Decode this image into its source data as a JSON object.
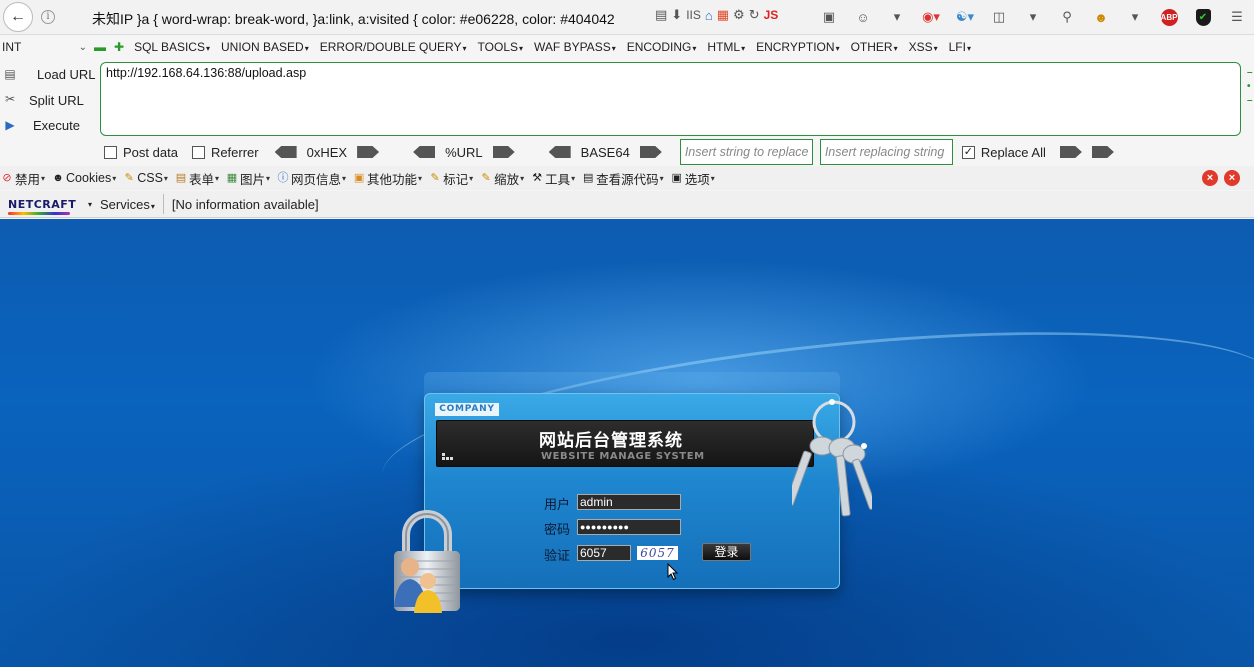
{
  "navbar": {
    "back_icon": "back-arrow-icon",
    "url_display": "未知IP    }a { word-wrap: break-word, }a:link, a:visited { color: #e06228, color: #404042",
    "js_label": "JS",
    "iis_label": "IIS",
    "abp_label": "ABP"
  },
  "hackbar": {
    "int_select": "INT",
    "menus": [
      "SQL BASICS",
      "UNION BASED",
      "ERROR/DOUBLE QUERY",
      "TOOLS",
      "WAF BYPASS",
      "ENCODING",
      "HTML",
      "ENCRYPTION",
      "OTHER",
      "XSS",
      "LFI"
    ],
    "load_url": "Load URL",
    "split_url": "Split URL",
    "execute": "Execute",
    "url_value": "http://192.168.64.136:88/upload.asp",
    "post_data": "Post data",
    "referrer": "Referrer",
    "hex": "0xHEX",
    "url_enc": "%URL",
    "base64": "BASE64",
    "insert_placeholder": "Insert string to replace",
    "replacing_placeholder": "Insert replacing string",
    "replace_all": "Replace All",
    "post_data_checked": false,
    "referrer_checked": false,
    "replace_all_checked": true
  },
  "webdev": {
    "items": [
      "禁用",
      "Cookies",
      "CSS",
      "表单",
      "图片",
      "网页信息",
      "其他功能",
      "标记",
      "缩放",
      "工具",
      "查看源代码",
      "选项"
    ]
  },
  "netcraft": {
    "logo": "NETCRAFT",
    "services": "Services",
    "info": "[No information available]"
  },
  "login": {
    "company": "COMPANY",
    "title_cn": "网站后台管理系统",
    "title_en": "WEBSITE MANAGE SYSTEM",
    "user_label": "用户",
    "user_value": "admin",
    "pass_label": "密码",
    "pass_value": "●●●●●●●●●",
    "verify_label": "验证",
    "verify_value": "6057",
    "captcha_text": "6057",
    "login_button": "登录"
  },
  "colors": {
    "page_bg": "#0a63bd",
    "panel": "#1e86cf",
    "hackbar_border": "#2f8f3f"
  }
}
